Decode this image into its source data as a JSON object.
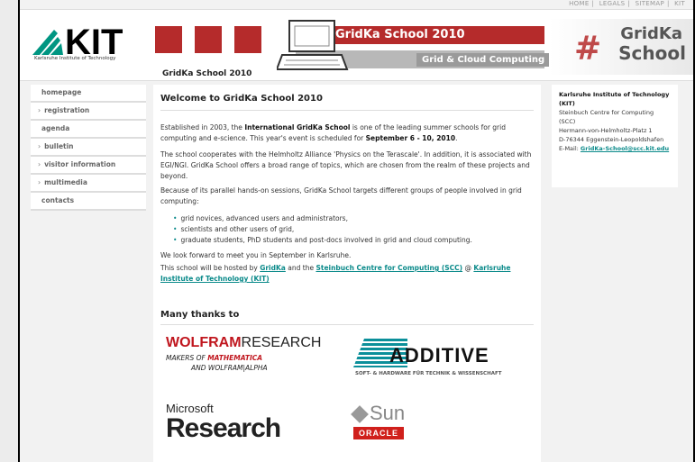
{
  "topnav": {
    "items": [
      "HOME",
      "LEGALS",
      "SITEMAP",
      "KIT"
    ]
  },
  "header": {
    "kit_caption": "Karlsruhe Institute of Technology",
    "banner_title": "GridKa School 2010",
    "banner_sub": "Grid & Cloud Computing",
    "site_name": "GridKa School 2010",
    "gridka_logo_1": "GridKa",
    "gridka_logo_2": "School"
  },
  "sidebar": {
    "items": [
      {
        "label": "homepage",
        "arrow": ""
      },
      {
        "label": "registration",
        "arrow": "›"
      },
      {
        "label": "agenda",
        "arrow": ""
      },
      {
        "label": "bulletin",
        "arrow": "›"
      },
      {
        "label": "visitor information",
        "arrow": "›"
      },
      {
        "label": "multimedia",
        "arrow": "›"
      },
      {
        "label": "contacts",
        "arrow": ""
      }
    ]
  },
  "main": {
    "title": "Welcome to GridKa School 2010",
    "p1_a": "Established in 2003, the ",
    "p1_b": "International GridKa School",
    "p1_c": " is one of the leading summer schools for grid computing and e-science. This year's event is scheduled for ",
    "p1_d": "September 6 - 10, 2010",
    "p1_e": ".",
    "p2": "The school cooperates with the Helmholtz Alliance 'Physics on the Terascale'. In addition, it is associated with EGI/NGI. GridKa School offers a broad range of topics, which are chosen from the realm of these projects and beyond.",
    "p3": "Because of its parallel hands-on sessions, GridKa School targets different groups of people involved in grid computing:",
    "bullets": [
      "grid novices, advanced users and administrators,",
      "scientists and other users of grid,",
      "graduate students, PhD students and post-docs involved in grid and cloud computing."
    ],
    "p4": "We look forward to meet you in September in Karlsruhe.",
    "p5_a": "This school will be hosted by ",
    "p5_link1": "GridKa",
    "p5_b": " and the ",
    "p5_link2": "Steinbuch Centre for Computing (SCC)",
    "p5_c": " @ ",
    "p5_link3": "Karlsruhe Institute of Technology (KIT)",
    "thanks_title": "Many thanks to"
  },
  "sponsors": {
    "wolfram_a": "WOLFRAM",
    "wolfram_b": "RESEARCH",
    "wolfram_sub1_a": "MAKERS OF ",
    "wolfram_sub1_b": "MATHEMATICA",
    "wolfram_sub2": "AND WOLFRAM|ALPHA",
    "additive_word": "ADDITIVE",
    "additive_sub": "SOFT- & HARDWARE FÜR TECHNIK & WISSENSCHAFT",
    "ms_top": "Microsoft",
    "ms_big": "Research",
    "sun_word": "Sun",
    "oracle": "ORACLE"
  },
  "address": {
    "org": "Karlsruhe Institute of Technology (KIT)",
    "line1": "Steinbuch Centre for Computing (SCC)",
    "line2": "Hermann-von-Helmholtz-Platz 1",
    "line3": "D-76344 Eggenstein-Leopoldshafen",
    "email_label": "E-Mail: ",
    "email": "GridKa-School@scc.kit.edu"
  }
}
